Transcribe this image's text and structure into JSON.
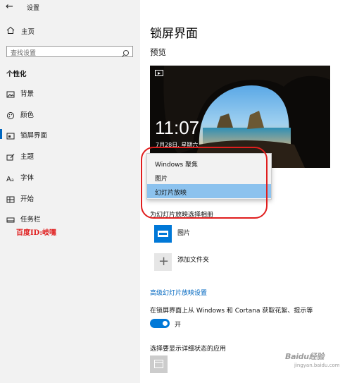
{
  "window": {
    "title": "设置"
  },
  "sidebar": {
    "home_label": "主页",
    "search_placeholder": "查找设置",
    "section_title": "个性化",
    "items": [
      {
        "label": "背景",
        "icon": "picture-icon"
      },
      {
        "label": "颜色",
        "icon": "palette-icon"
      },
      {
        "label": "锁屏界面",
        "icon": "lock-screen-icon",
        "active": true
      },
      {
        "label": "主题",
        "icon": "brush-icon"
      },
      {
        "label": "字体",
        "icon": "font-icon"
      },
      {
        "label": "开始",
        "icon": "start-icon"
      },
      {
        "label": "任务栏",
        "icon": "taskbar-icon"
      }
    ],
    "overlay_note": "百度ID:岐嘿"
  },
  "main": {
    "title": "锁屏界面",
    "preview_label": "预览",
    "preview": {
      "time": "11:07",
      "date": "7月28日, 星期六"
    },
    "background_dropdown": {
      "options": [
        "Windows 聚焦",
        "图片",
        "幻灯片放映"
      ],
      "selected": "幻灯片放映"
    },
    "album_label": "为幻灯片放映选择相册",
    "albums": [
      {
        "label": "图片",
        "icon": "pictures-folder-icon"
      },
      {
        "label": "添加文件夹",
        "icon": "plus-icon"
      }
    ],
    "advanced_link": "高级幻灯片放映设置",
    "fun_facts_label": "在锁屏界面上从 Windows 和 Cortana 获取花絮、提示等",
    "fun_facts_toggle": {
      "state": "开",
      "on": true
    },
    "detailed_status_label": "选择要显示详细状态的应用"
  },
  "colors": {
    "accent": "#0078d7",
    "selection": "#8cc2ee",
    "annotation": "#e01e1e"
  },
  "watermark": {
    "brand": "Baidu经验",
    "url": "jingyan.baidu.com"
  }
}
